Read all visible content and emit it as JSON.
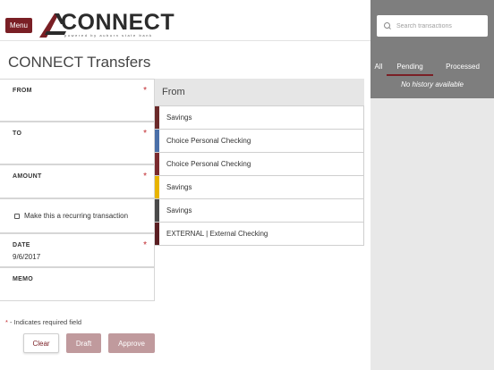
{
  "header": {
    "menu_label": "Menu",
    "logo_word": "CONNECT",
    "logo_tagline": "powered by Auburn State Bank"
  },
  "page": {
    "title": "CONNECT Transfers"
  },
  "form": {
    "from_label": "FROM",
    "to_label": "TO",
    "amount_label": "AMOUNT",
    "recurring_label": "Make this a recurring transaction",
    "date_label": "DATE",
    "date_value": "9/6/2017",
    "memo_label": "MEMO",
    "required_star": "*",
    "required_note": " - Indicates required field"
  },
  "buttons": {
    "clear": "Clear",
    "draft": "Draft",
    "approve": "Approve"
  },
  "picker": {
    "title": "From",
    "accounts": [
      {
        "name": "Savings",
        "color": "#6b2a2a"
      },
      {
        "name": "Choice Personal Checking",
        "color": "#4a6fa8"
      },
      {
        "name": "Choice Personal Checking",
        "color": "#7a2a2e"
      },
      {
        "name": "Savings",
        "color": "#e8b400"
      },
      {
        "name": "Savings",
        "color": "#4a4a4a"
      },
      {
        "name": "EXTERNAL | External Checking",
        "color": "#5a1e22"
      }
    ]
  },
  "transactions": {
    "search_placeholder": "Search transactions",
    "tabs": [
      "All",
      "Pending",
      "Processed"
    ],
    "active_tab": "Pending",
    "empty_text": "No history available"
  },
  "colors": {
    "brand": "#7a1f25",
    "disabled_button": "#c09a9d",
    "panel_dark": "#7e7e7e",
    "panel_light": "#e8e8e8",
    "required": "#c0282d"
  }
}
